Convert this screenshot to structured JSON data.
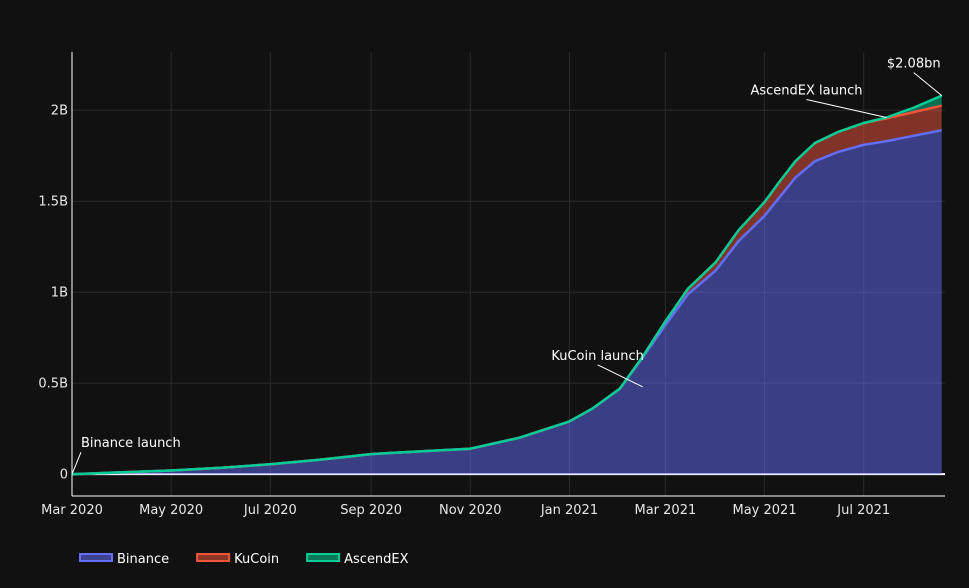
{
  "chart_data": {
    "type": "area",
    "stacked": true,
    "title": "",
    "xlabel": "",
    "ylabel": "",
    "grid": true,
    "legend_position": "bottom-left",
    "x_range": [
      "2020-03-01",
      "2021-08-20"
    ],
    "ylim": [
      -0.12,
      2.32
    ],
    "x_ticks": [
      {
        "date": "2020-03-01",
        "label": "Mar 2020"
      },
      {
        "date": "2020-05-01",
        "label": "May 2020"
      },
      {
        "date": "2020-07-01",
        "label": "Jul 2020"
      },
      {
        "date": "2020-09-01",
        "label": "Sep 2020"
      },
      {
        "date": "2020-11-01",
        "label": "Nov 2020"
      },
      {
        "date": "2021-01-01",
        "label": "Jan 2021"
      },
      {
        "date": "2021-03-01",
        "label": "Mar 2021"
      },
      {
        "date": "2021-05-01",
        "label": "May 2021"
      },
      {
        "date": "2021-07-01",
        "label": "Jul 2021"
      }
    ],
    "y_ticks": [
      {
        "value": 0,
        "label": "0"
      },
      {
        "value": 0.5,
        "label": "0.5B"
      },
      {
        "value": 1,
        "label": "1B"
      },
      {
        "value": 1.5,
        "label": "1.5B"
      },
      {
        "value": 2,
        "label": "2B"
      }
    ],
    "x": [
      "2020-03-01",
      "2020-04-01",
      "2020-05-01",
      "2020-06-01",
      "2020-07-01",
      "2020-08-01",
      "2020-09-01",
      "2020-10-01",
      "2020-11-01",
      "2020-12-01",
      "2021-01-01",
      "2021-01-15",
      "2021-02-01",
      "2021-02-15",
      "2021-03-01",
      "2021-03-15",
      "2021-04-01",
      "2021-04-15",
      "2021-05-01",
      "2021-05-10",
      "2021-05-20",
      "2021-06-01",
      "2021-06-15",
      "2021-07-01",
      "2021-07-15",
      "2021-08-01",
      "2021-08-18"
    ],
    "series": [
      {
        "name": "Binance",
        "color": "#636efa",
        "values": [
          0,
          0.01,
          0.02,
          0.035,
          0.055,
          0.08,
          0.11,
          0.125,
          0.14,
          0.2,
          0.29,
          0.36,
          0.47,
          0.64,
          0.82,
          0.99,
          1.12,
          1.28,
          1.42,
          1.52,
          1.63,
          1.72,
          1.77,
          1.81,
          1.83,
          1.86,
          1.89
        ]
      },
      {
        "name": "KuCoin",
        "color": "#ef553b",
        "values": [
          0,
          0,
          0,
          0,
          0,
          0,
          0,
          0,
          0,
          0,
          0,
          0,
          0,
          0.005,
          0.02,
          0.03,
          0.045,
          0.06,
          0.075,
          0.085,
          0.09,
          0.1,
          0.11,
          0.12,
          0.125,
          0.13,
          0.135
        ]
      },
      {
        "name": "AscendEX",
        "color": "#00cc96",
        "values": [
          0,
          0,
          0,
          0,
          0,
          0,
          0,
          0,
          0,
          0,
          0,
          0,
          0,
          0,
          0,
          0,
          0,
          0,
          0,
          0,
          0,
          0,
          0,
          0,
          0.005,
          0.025,
          0.055
        ]
      }
    ],
    "annotations": [
      {
        "text": "Binance launch",
        "date": "2020-03-01",
        "value": 0
      },
      {
        "text": "KuCoin launch",
        "date": "2021-02-15",
        "value": 0.48
      },
      {
        "text": "AscendEX launch",
        "date": "2021-07-15",
        "value": 1.96
      },
      {
        "text": "$2.08bn",
        "date": "2021-08-18",
        "value": 2.08
      }
    ]
  }
}
